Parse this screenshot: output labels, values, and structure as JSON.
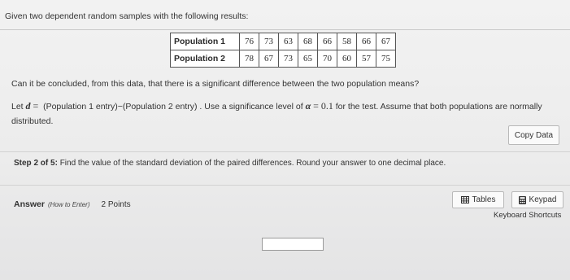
{
  "intro_text": "Given two dependent random samples with the following results:",
  "table": {
    "rows": [
      {
        "label": "Population 1",
        "values": [
          "76",
          "73",
          "63",
          "68",
          "66",
          "58",
          "66",
          "67"
        ]
      },
      {
        "label": "Population 2",
        "values": [
          "78",
          "67",
          "73",
          "65",
          "70",
          "60",
          "57",
          "75"
        ]
      }
    ]
  },
  "question": "Can it be concluded, from this data, that there is a significant difference between the two population means?",
  "letd": {
    "prefix": "Let",
    "var": "d",
    "eq": "=",
    "definition": "(Population 1 entry)−(Population 2 entry)",
    "sig_text_a": ". Use a significance level of",
    "alpha": "α",
    "alpha_eq": "=",
    "alpha_value": "0.1",
    "sig_text_b": "for the test. Assume that both populations are normally distributed."
  },
  "copy_data_label": "Copy Data",
  "step": {
    "label": "Step 2 of 5:",
    "text": "Find the value of the standard deviation of the paired differences. Round your answer to one decimal place."
  },
  "answer": {
    "label": "Answer",
    "how_to": "(How to Enter)",
    "points": "2 Points",
    "value": ""
  },
  "buttons": {
    "tables": "Tables",
    "keypad": "Keypad",
    "shortcuts": "Keyboard Shortcuts"
  },
  "icons": {
    "tables": "table-grid-icon",
    "keypad": "calculator-icon"
  }
}
